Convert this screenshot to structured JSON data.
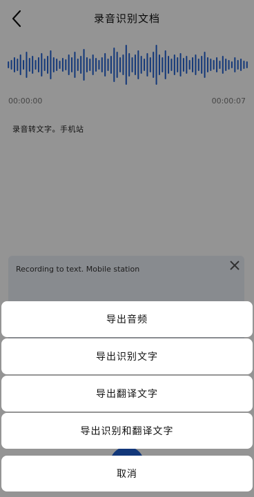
{
  "header": {
    "title": "录音识别文档",
    "back_icon": "chevron-left-icon"
  },
  "waveform": {
    "color": "#1f5fd1"
  },
  "timeline": {
    "start": "00:00:00",
    "end": "00:00:07"
  },
  "transcript": {
    "text": "录音转文字。手机站"
  },
  "translation": {
    "text": "Recording to text. Mobile station",
    "close_icon": "close-icon"
  },
  "action_sheet": {
    "items": [
      {
        "label": "导出音频"
      },
      {
        "label": "导出识别文字"
      },
      {
        "label": "导出翻译文字"
      },
      {
        "label": "导出识别和翻译文字"
      }
    ],
    "cancel_label": "取消"
  },
  "colors": {
    "accent": "#1f5fd1",
    "overlay": "rgba(0,0,0,0.42)"
  }
}
